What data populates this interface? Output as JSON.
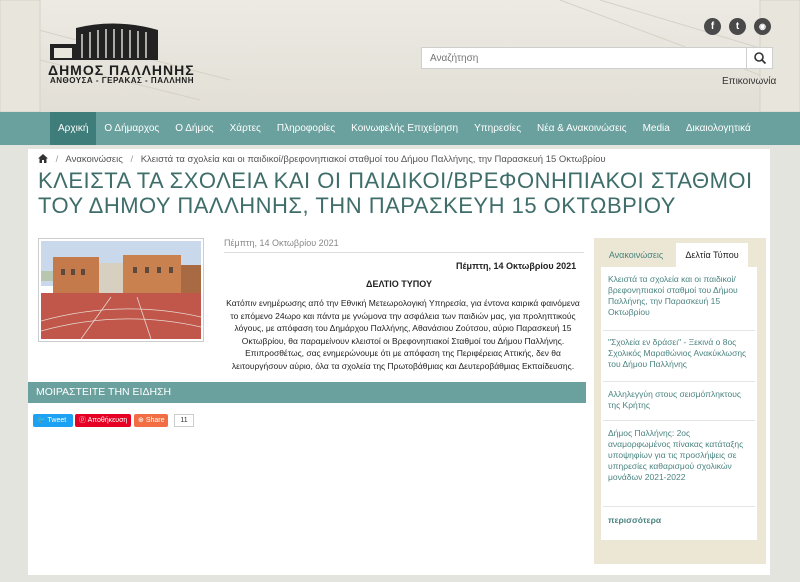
{
  "header": {
    "logo_title": "ΔΗΜΟΣ ΠΑΛΛΗΝΗΣ",
    "logo_subtitle": "ΑΝΘΟΥΣΑ - ΓΕΡΑΚΑΣ - ΠΑΛΛΗΝΗ",
    "social": [
      {
        "icon": "facebook-icon",
        "glyph": "f"
      },
      {
        "icon": "twitter-icon",
        "glyph": "t"
      },
      {
        "icon": "rss-icon",
        "glyph": "◉"
      }
    ],
    "search_placeholder": "Αναζήτηση",
    "contact_label": "Επικοινωνία"
  },
  "nav": {
    "items": [
      {
        "label": "Αρχική",
        "active": true
      },
      {
        "label": "Ο Δήμαρχος"
      },
      {
        "label": "Ο Δήμος"
      },
      {
        "label": "Χάρτες"
      },
      {
        "label": "Πληροφορίες"
      },
      {
        "label": "Κοινωφελής Επιχείρηση"
      },
      {
        "label": "Υπηρεσίες"
      },
      {
        "label": "Νέα & Ανακοινώσεις"
      },
      {
        "label": "Media"
      },
      {
        "label": "Δικαιολογητικά"
      }
    ]
  },
  "breadcrumb": {
    "home_icon": "home-icon",
    "items": [
      "Ανακοινώσεις",
      "Κλειστά τα σχολεία και οι παιδικοί/βρεφονηπιακοί σταθμοί του Δήμου Παλλήνης, την Παρασκευή 15 Οκτωβρίου"
    ]
  },
  "article": {
    "title": "ΚΛΕΙΣΤΑ ΤΑ ΣΧΟΛΕΙΑ ΚΑΙ ΟΙ ΠΑΙΔΙΚΟΙ/ΒΡΕΦΟΝΗΠΙΑΚΟΙ ΣΤΑΘΜΟΙ ΤΟΥ ΔΗΜΟΥ ΠΑΛΛΗΝΗΣ, ΤΗΝ ΠΑΡΑΣΚΕΥΗ 15 ΟΚΤΩΒΡΙΟΥ",
    "date": "Πέμπτη, 14 Οκτωβρίου 2021",
    "date_bold": "Πέμπτη, 14 Οκτωβρίου 2021",
    "press_label": "ΔΕΛΤΙΟ ΤΥΠΟΥ",
    "body": "Κατόπιν ενημέρωσης από την Εθνική Μετεωρολογική Υπηρεσία, για έντονα καιρικά φαινόμενα το επόμενο 24ωρο και πάντα με γνώμονα την ασφάλεια των παιδιών μας, για προληπτικούς λόγους, με απόφαση του Δημάρχου Παλλήνης, Αθανάσιου Ζούτσου, αύριο Παρασκευή 15 Οκτωβρίου, θα παραμείνουν κλειστοί οι Βρεφονηπιακοί Σταθμοί του Δήμου Παλλήνης. Επιπροσθέτως, σας ενημερώνουμε ότι με απόφαση της Περιφέρειας Αττικής, δεν θα λειτουργήσουν αύριο, όλα τα σχολεία της Πρωτοβάθμιας και Δευτεροβάθμιας Εκπαίδευσης."
  },
  "share": {
    "heading": "ΜΟΙΡΑΣΤΕΙΤΕ ΤΗΝ ΕΙΔΗΣΗ",
    "tweet": "Tweet",
    "pinterest": "Αποθήκευση",
    "share": "Share",
    "count": "11"
  },
  "sidebar": {
    "tabs": [
      "Ανακοινώσεις",
      "Δελτία Τύπου"
    ],
    "items": [
      "Κλειστά τα σχολεία και οι παιδικοί/ βρεφονηπιακοί σταθμοί του Δήμου Παλλήνης, την Παρασκευή 15 Οκτωβρίου",
      "\"Σχολεία εν δράσει\" - Ξεκινά ο 8ος Σχολικός Μαραθώνιος Ανακύκλωσης του Δήμου Παλλήνης",
      "Αλληλεγγύη στους σεισμόπληκτους της Κρήτης",
      "Δήμος Παλλήνης: 2ος αναμορφωμένος πίνακας κατάταξης υποψηφίων για τις προσλήψεις σε υπηρεσίες καθαρισμού σχολικών μονάδων 2021-2022"
    ],
    "more": "περισσότερα"
  },
  "colors": {
    "nav": "#6aa09d",
    "nav_active": "#3f7d7a",
    "title": "#3e6d6a",
    "link": "#4a8480",
    "sidebar_bg": "#ebe7d4"
  }
}
